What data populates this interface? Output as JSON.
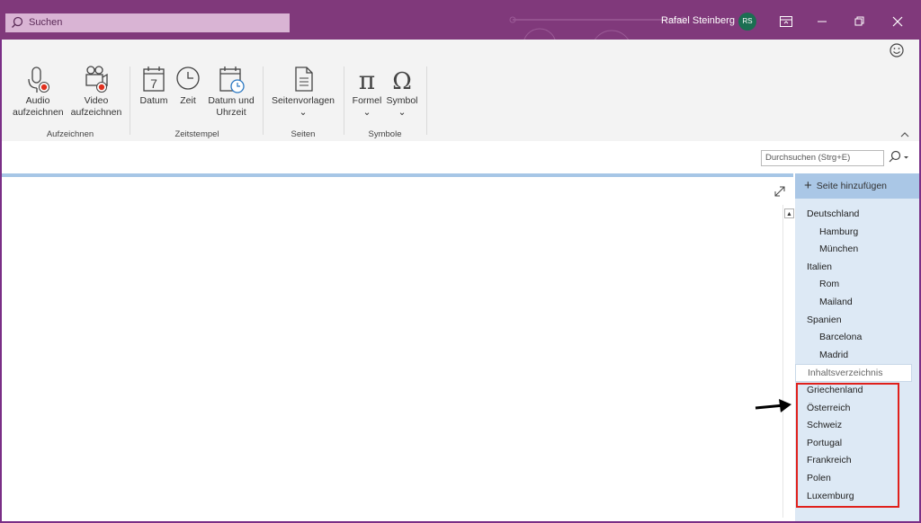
{
  "titlebar": {
    "search_placeholder": "Suchen",
    "user_name": "Rafael Steinberg",
    "user_initials": "RS"
  },
  "ribbon": {
    "groups": [
      {
        "label": "Aufzeichnen",
        "commands": [
          {
            "line1": "Audio",
            "line2": "aufzeichnen"
          },
          {
            "line1": "Video",
            "line2": "aufzeichnen"
          }
        ]
      },
      {
        "label": "Zeitstempel",
        "commands": [
          {
            "line1": "Datum",
            "line2": ""
          },
          {
            "line1": "Zeit",
            "line2": ""
          },
          {
            "line1": "Datum und",
            "line2": "Uhrzeit"
          }
        ]
      },
      {
        "label": "Seiten",
        "commands": [
          {
            "line1": "Seitenvorlagen",
            "line2": "⌄"
          }
        ]
      },
      {
        "label": "Symbole",
        "commands": [
          {
            "line1": "Formel",
            "line2": "⌄"
          },
          {
            "line1": "Symbol",
            "line2": "⌄"
          }
        ]
      }
    ]
  },
  "notebook_search": {
    "placeholder": "Durchsuchen (Strg+E)"
  },
  "page_pane": {
    "add_page_label": "Seite hinzufügen",
    "pages": [
      {
        "label": "Deutschland",
        "level": 1
      },
      {
        "label": "Hamburg",
        "level": 2
      },
      {
        "label": "München",
        "level": 2
      },
      {
        "label": "Italien",
        "level": 1
      },
      {
        "label": "Rom",
        "level": 2
      },
      {
        "label": "Mailand",
        "level": 2
      },
      {
        "label": "Spanien",
        "level": 1
      },
      {
        "label": "Barcelona",
        "level": 2
      },
      {
        "label": "Madrid",
        "level": 2
      },
      {
        "label": "Inhaltsverzeichnis",
        "level": 1,
        "selected": true
      },
      {
        "label": "Griechenland",
        "level": 1
      },
      {
        "label": "Österreich",
        "level": 1
      },
      {
        "label": "Schweiz",
        "level": 1
      },
      {
        "label": "Portugal",
        "level": 1
      },
      {
        "label": "Frankreich",
        "level": 1
      },
      {
        "label": "Polen",
        "level": 1
      },
      {
        "label": "Luxemburg",
        "level": 1
      }
    ]
  },
  "colors": {
    "titlebar": "#80397b",
    "highlight": "#e0201c",
    "pane": "#dde9f5"
  }
}
